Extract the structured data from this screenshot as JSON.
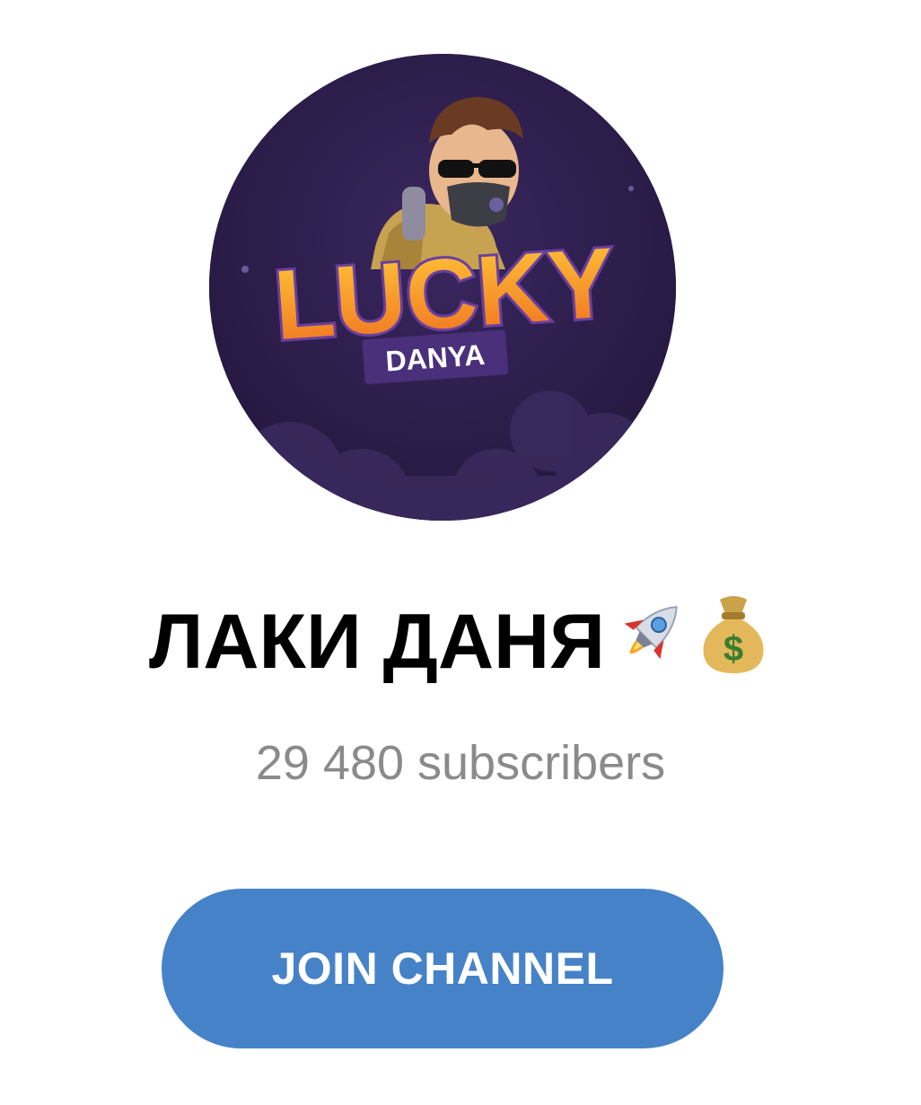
{
  "channel": {
    "name": "ЛАКИ ДАНЯ",
    "subscribers": "29 480 subscribers",
    "avatar": {
      "logo_main": "LUCKY",
      "logo_sub": "DANYA",
      "icon": "channel-avatar"
    },
    "title_emojis": [
      "rocket-icon",
      "money-bag-icon"
    ]
  },
  "join_button": {
    "label": "JOIN CHANNEL"
  },
  "colors": {
    "accent": "#4682c8",
    "subtitle": "#8a8a8a",
    "avatar_bg": "#2a1b44",
    "logo_orange": "#f39a2c"
  }
}
